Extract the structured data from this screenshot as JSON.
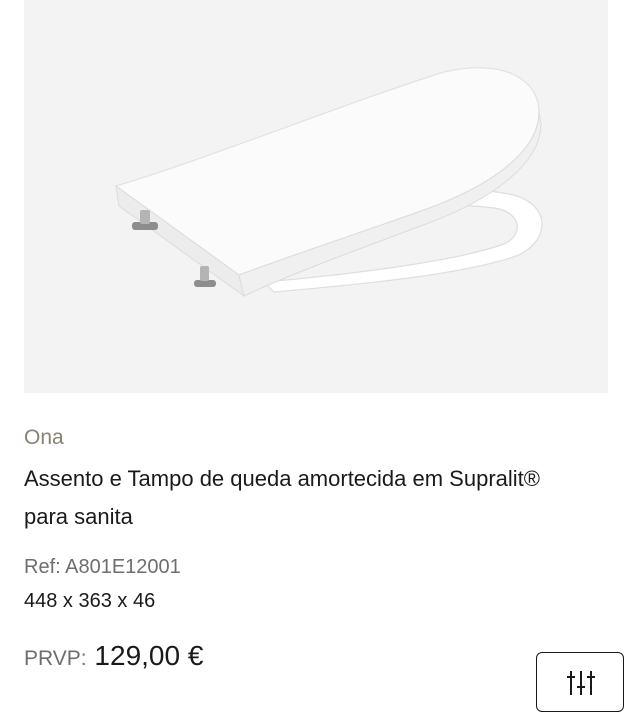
{
  "product": {
    "image_icon": "toilet-seat-image",
    "collection": "Ona",
    "title": "Assento e Tampo de queda amortecida em Supralit® para sanita",
    "ref": "Ref: A801E12001",
    "dimensions": "448 x 363 x 46",
    "price_label": "PRVP:",
    "price_value": " 129,00 €"
  },
  "actions": {
    "compare_icon": "sliders-icon"
  },
  "colors": {
    "image_background": "#f3f3f3",
    "collection_text": "#8a8170",
    "muted_text": "#6e6e6e",
    "primary_text": "#1a1a1a"
  }
}
